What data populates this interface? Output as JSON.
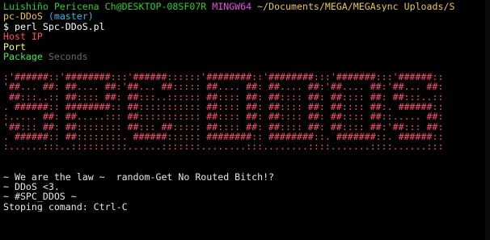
{
  "prompt": {
    "user_host": "Luishiño Pericena Ch@DESKTOP-08SF07R",
    "shell": "MINGW64",
    "path_line1": "~/Documents/MEGA/MEGAsync Uploads/S",
    "path_line2": "pc-DDoS",
    "branch": "(master)"
  },
  "command": "$ perl Spc-DDoS.pl",
  "inputs": {
    "host_label": "Host IP",
    "port_label": "Port",
    "package_label": "Package",
    "seconds_label": "Seconds"
  },
  "banner": [
    ":'######::'########:::'######::::::'########::'########:::'#######:::'######::",
    "'##... ##: ##.... ##:'##... ##::::: ##.... ##: ##.... ##:'##.... ##:'##... ##:",
    " ##:::..:: ##:::: ##: ##:::..:::::: ##:::: ##: ##:::: ##: ##:::: ##: ##:::..::",
    ". ######:: ########:: ##::::::::::: ##:::: ##: ##:::: ##: ##:::: ##:. ######::",
    ":..... ##: ##.....::: ##::::::::::: ##:::: ##: ##:::: ##: ##:::: ##::..... ##:",
    "'##::: ##: ##:::::::: ##::: ##::::: ##:::: ##: ##:::: ##: ##:::: ##:'##::: ##:",
    ". ######:: ##::::::::. ######:::::: ########:: ########::. #######::. ######::",
    ":......:::..::::::::::......:::::::........:::........::::.......::::......:::"
  ],
  "messages": [
    "~ We are the law ~  random-Get No Routed Bitch!?",
    "~ DDoS <3.",
    "~ #SPC_DDOS ~",
    "Stoping comand: Ctrl-C"
  ]
}
